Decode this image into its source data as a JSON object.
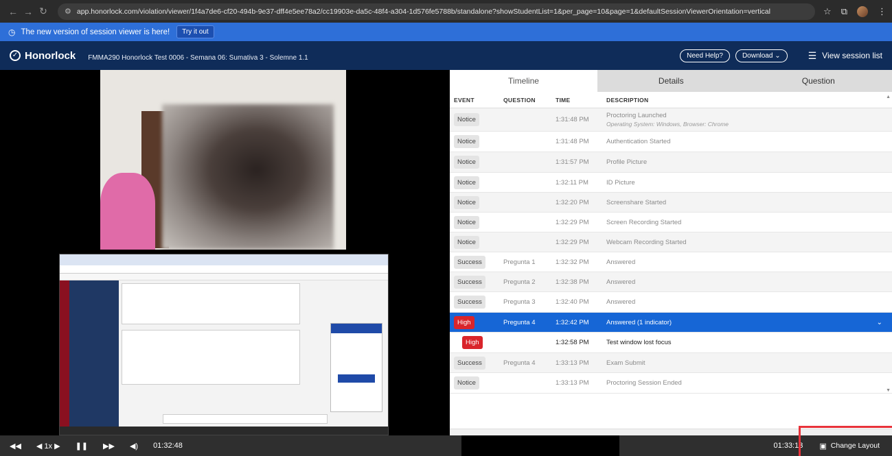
{
  "browser": {
    "url": "app.honorlock.com/violation/viewer/1f4a7de6-cf20-494b-9e37-dff4e5ee78a2/cc19903e-da5c-48f4-a304-1d576fe5788b/standalone?showStudentList=1&per_page=10&page=1&defaultSessionViewerOrientation=vertical",
    "back_icon": "arrow-left-icon",
    "forward_icon": "arrow-right-icon",
    "reload_icon": "reload-icon"
  },
  "notice": {
    "text": "The new version of session viewer is here!",
    "button": "Try it out"
  },
  "header": {
    "logo": "Honorlock",
    "exam_title": "FMMA290 Honorlock Test 0006  -  Semana 06: Sumativa 3 - Solemne 1.1",
    "help_btn": "Need Help?",
    "download_btn": "Download",
    "session_list": "View session list"
  },
  "tabs": [
    {
      "label": "Timeline"
    },
    {
      "label": "Details"
    },
    {
      "label": "Question"
    }
  ],
  "table": {
    "headers": {
      "event": "EVENT",
      "question": "QUESTION",
      "time": "TIME",
      "description": "DESCRIPTION"
    },
    "rows": [
      {
        "event": "Notice",
        "question": "",
        "time": "1:31:48 PM",
        "description": "Proctoring Launched",
        "sub": "Operating System: Windows, Browser: Chrome"
      },
      {
        "event": "Notice",
        "question": "",
        "time": "1:31:48 PM",
        "description": "Authentication Started",
        "sub": ""
      },
      {
        "event": "Notice",
        "question": "",
        "time": "1:31:57 PM",
        "description": "Profile Picture",
        "sub": ""
      },
      {
        "event": "Notice",
        "question": "",
        "time": "1:32:11 PM",
        "description": "ID Picture",
        "sub": ""
      },
      {
        "event": "Notice",
        "question": "",
        "time": "1:32:20 PM",
        "description": "Screenshare Started",
        "sub": ""
      },
      {
        "event": "Notice",
        "question": "",
        "time": "1:32:29 PM",
        "description": "Screen Recording Started",
        "sub": ""
      },
      {
        "event": "Notice",
        "question": "",
        "time": "1:32:29 PM",
        "description": "Webcam Recording Started",
        "sub": ""
      },
      {
        "event": "Success",
        "question": "Pregunta 1",
        "time": "1:32:32 PM",
        "description": "Answered",
        "sub": ""
      },
      {
        "event": "Success",
        "question": "Pregunta 2",
        "time": "1:32:38 PM",
        "description": "Answered",
        "sub": ""
      },
      {
        "event": "Success",
        "question": "Pregunta 3",
        "time": "1:32:40 PM",
        "description": "Answered",
        "sub": ""
      },
      {
        "event": "High",
        "question": "Pregunta 4",
        "time": "1:32:42 PM",
        "description": "Answered (1 indicator)",
        "sub": ""
      },
      {
        "event": "High",
        "question": "",
        "time": "1:32:58 PM",
        "description": "Test window lost focus",
        "sub": ""
      },
      {
        "event": "Success",
        "question": "Pregunta 4",
        "time": "1:33:13 PM",
        "description": "Exam Submit",
        "sub": ""
      },
      {
        "event": "Notice",
        "question": "",
        "time": "1:33:13 PM",
        "description": "Proctoring Session Ended",
        "sub": ""
      }
    ]
  },
  "controls": {
    "rewind": "◀◀",
    "speed": "◀ 1x ▶",
    "pause": "❚❚",
    "forward": "▶▶",
    "volume": "◀)",
    "current_time": "01:32:48",
    "end_time": "01:33:13",
    "change_layout": "Change Layout"
  },
  "colors": {
    "header_bg": "#0f2c59",
    "notice_bg": "#2e6fd8",
    "selected_row": "#1666d6",
    "high_badge": "#d9252b",
    "highlight_frame": "#e8323a"
  }
}
